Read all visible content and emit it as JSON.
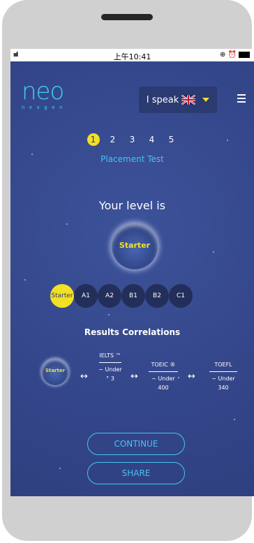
{
  "status": {
    "time": "上午10:41",
    "signal": "ııl",
    "right_icons": "⊕ ⏰"
  },
  "logo": {
    "word": "neo",
    "sub": "nexgen"
  },
  "language": {
    "label": "I speak"
  },
  "steps": {
    "items": [
      "1",
      "2",
      "3",
      "4",
      "5"
    ],
    "active": 0,
    "label": "Placement Test"
  },
  "level": {
    "title": "Your level is",
    "planet_label": "Starter"
  },
  "levels": {
    "items": [
      "Starter",
      "A1",
      "A2",
      "B1",
      "B2",
      "C1"
    ],
    "active": 0
  },
  "correlations": {
    "title": "Results Correlations",
    "badge": "Starter",
    "ielts": {
      "name": "IELTS ™",
      "value": "~ Under ° 3"
    },
    "toeic": {
      "name": "TOEIC ®",
      "value": "~ Under 400"
    },
    "toefl": {
      "name": "TOEFL",
      "value": "~ Under 340"
    },
    "arrow": "↔"
  },
  "buttons": {
    "continue": "CONTINUE",
    "share": "SHARE"
  },
  "colors": {
    "accent_yellow": "#f2e024",
    "accent_cyan": "#3fd0e8",
    "background": "#364a8e"
  }
}
